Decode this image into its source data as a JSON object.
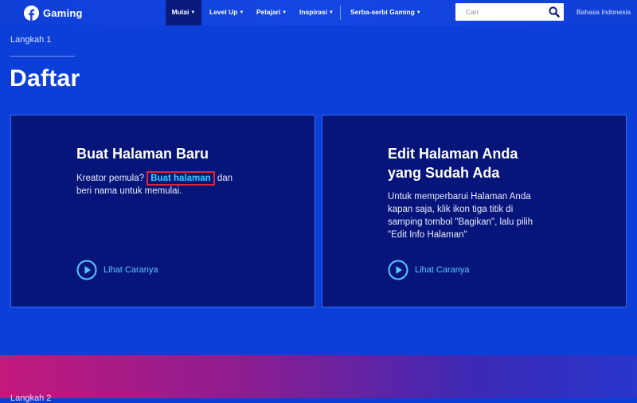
{
  "nav": {
    "brand": "Gaming",
    "items": [
      {
        "label": "Mulai",
        "active": true
      },
      {
        "label": "Level Up",
        "active": false
      },
      {
        "label": "Pelajari",
        "active": false
      },
      {
        "label": "Inspirasi",
        "active": false
      },
      {
        "label": "Serba-serbi Gaming",
        "active": false
      }
    ],
    "search_placeholder": "Cari",
    "language": "Bahasa Indonesia"
  },
  "step": {
    "label": "Langkah 1",
    "title": "Daftar"
  },
  "cards": [
    {
      "title": "Buat Halaman Baru",
      "text_before": "Kreator pemula?",
      "link": "Buat halaman",
      "text_after": "dan",
      "text_line2": "beri nama untuk memulai.",
      "action": "Lihat Caranya"
    },
    {
      "title_line1": "Edit Halaman Anda",
      "title_line2": "yang Sudah Ada",
      "text_line1": "Untuk memperbarui Halaman Anda",
      "text_line2": "kapan saja, klik ikon tiga titik di",
      "text_line3": "samping tombol \"Bagikan\", lalu pilih",
      "text_line4": "\"Edit Info Halaman\"",
      "action": "Lihat Caranya"
    }
  ],
  "next_step": {
    "label": "Langkah 2"
  },
  "colors": {
    "background": "#0b3fd8",
    "card": "#07157a",
    "accent": "#29d3ff",
    "highlight_border": "#e0262c"
  }
}
